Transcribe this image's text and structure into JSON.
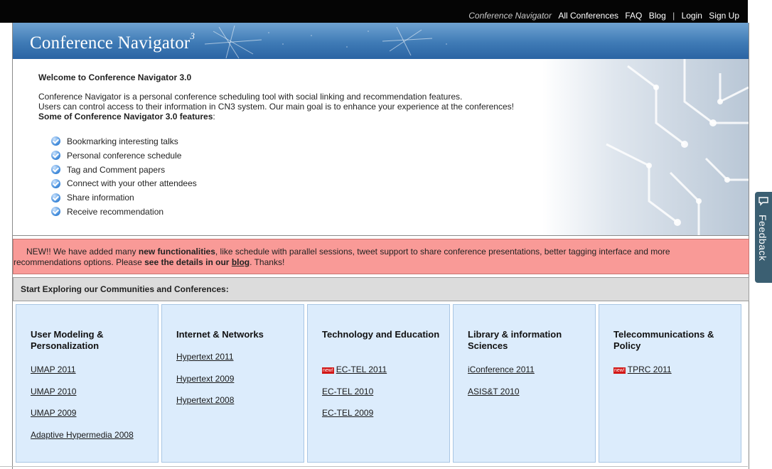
{
  "topnav": {
    "brand": "Conference Navigator",
    "items": [
      "All Conferences",
      "FAQ",
      "Blog",
      "|",
      "Login",
      "Sign Up"
    ]
  },
  "banner": {
    "logo_main": "Conference Navigator",
    "logo_sup": "3"
  },
  "welcome": {
    "title": "Welcome to Conference Navigator 3.0",
    "line1": "Conference Navigator is a personal conference scheduling tool with social linking and recommendation features.",
    "line2": "Users can control access to their information in CN3 system. Our main goal is to enhance your experience at the conferences!",
    "features_heading": "Some of Conference Navigator 3.0 features",
    "features_heading_suffix": ":",
    "features": [
      "Bookmarking interesting talks",
      "Personal conference schedule",
      "Tag and Comment papers",
      "Connect with your other attendees",
      "Share information",
      "Receive recommendation"
    ]
  },
  "news": {
    "prefix": "NEW!! We have added many ",
    "bold1": "new functionalities",
    "middle": ", like schedule with parallel sessions, tweet support to share conference presentations, better tagging interface and more",
    "line2_prefix": "recommendations options. Please ",
    "bold2": "see the details in our ",
    "link": "blog",
    "suffix": ". Thanks!"
  },
  "explore": {
    "title": "Start Exploring our Communities and Conferences:"
  },
  "communities": [
    {
      "title": "User Modeling & Personalization",
      "links": [
        {
          "label": "UMAP 2011",
          "new": false
        },
        {
          "label": "UMAP 2010",
          "new": false
        },
        {
          "label": "UMAP 2009",
          "new": false
        },
        {
          "label": "Adaptive Hypermedia 2008",
          "new": false
        }
      ]
    },
    {
      "title": "Internet & Networks",
      "links": [
        {
          "label": "Hypertext 2011",
          "new": false
        },
        {
          "label": "Hypertext 2009",
          "new": false
        },
        {
          "label": "Hypertext 2008",
          "new": false
        }
      ]
    },
    {
      "title": "Technology and Education",
      "links": [
        {
          "label": "EC-TEL 2011",
          "new": true
        },
        {
          "label": "EC-TEL 2010",
          "new": false
        },
        {
          "label": "EC-TEL 2009",
          "new": false
        }
      ]
    },
    {
      "title": "Library & information Sciences",
      "links": [
        {
          "label": "iConference 2011",
          "new": false
        },
        {
          "label": "ASIS&T 2010",
          "new": false
        }
      ]
    },
    {
      "title": "Telecommunications & Policy",
      "links": [
        {
          "label": "TPRC 2011",
          "new": true
        }
      ]
    }
  ],
  "new_badge": "new!",
  "feedback": {
    "label": "Feedback"
  },
  "colors": {
    "banner": "#3f7bb6",
    "news_bg": "#f99a97",
    "card_bg": "#dcecfc",
    "feedback": "#3b5f72"
  }
}
